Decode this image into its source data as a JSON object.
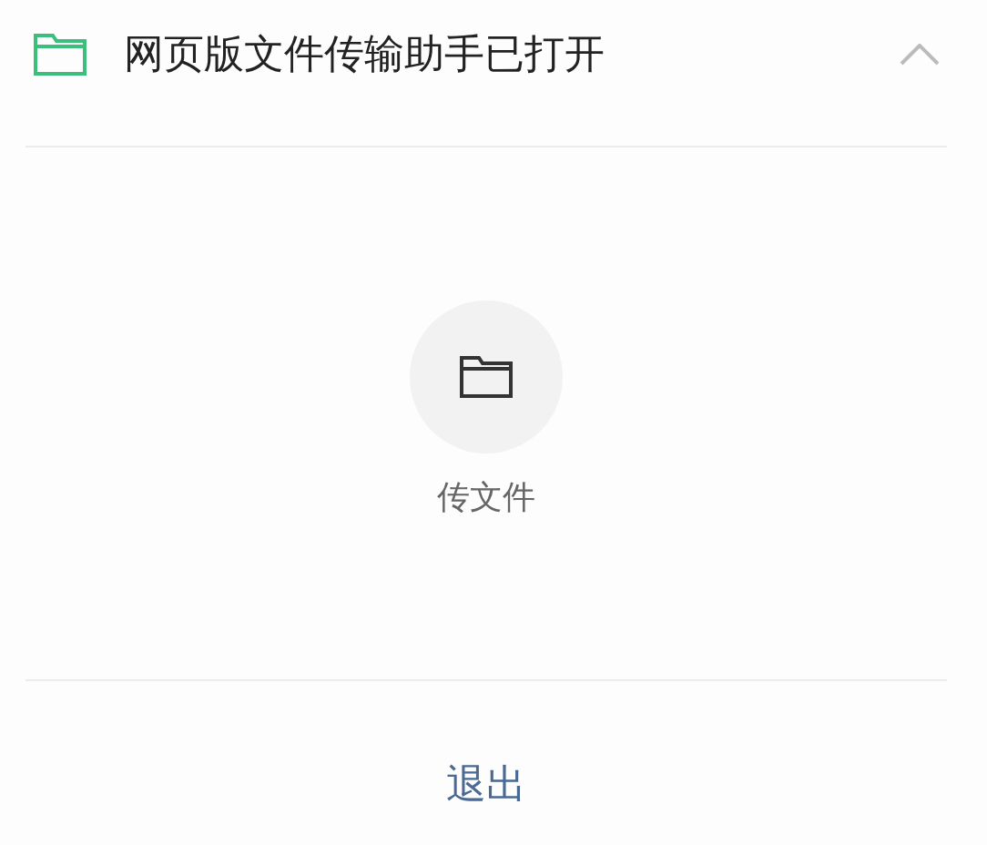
{
  "header": {
    "title": "网页版文件传输助手已打开",
    "expanded": true
  },
  "actions": [
    {
      "label": "传文件"
    }
  ],
  "logout": {
    "label": "退出"
  }
}
